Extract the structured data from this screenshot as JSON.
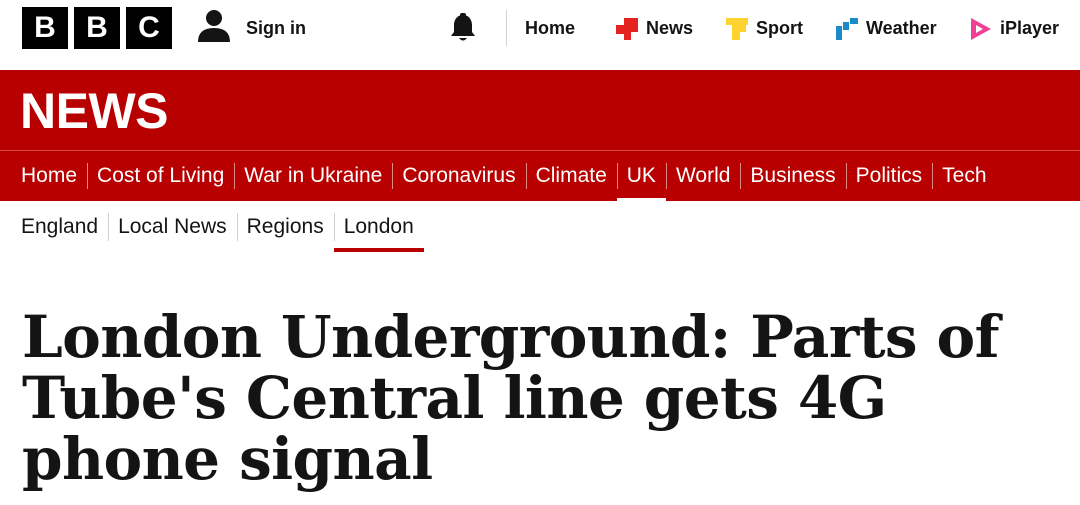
{
  "brand": {
    "letters": [
      "B",
      "B",
      "C"
    ]
  },
  "top_bar": {
    "sign_in_label": "Sign in",
    "nav": [
      {
        "label": "Home",
        "icon": "none"
      },
      {
        "label": "News",
        "icon": "news-icon"
      },
      {
        "label": "Sport",
        "icon": "sport-icon"
      },
      {
        "label": "Weather",
        "icon": "weather-icon"
      },
      {
        "label": "iPlayer",
        "icon": "iplayer-icon"
      }
    ]
  },
  "banner": {
    "title": "NEWS"
  },
  "main_nav": {
    "items": [
      "Home",
      "Cost of Living",
      "War in Ukraine",
      "Coronavirus",
      "Climate",
      "UK",
      "World",
      "Business",
      "Politics",
      "Tech"
    ],
    "active": "UK"
  },
  "sub_nav": {
    "items": [
      "England",
      "Local News",
      "Regions",
      "London"
    ],
    "active": "London"
  },
  "article": {
    "headline": "London Underground: Parts of Tube's Central line gets 4G phone signal"
  },
  "colors": {
    "brand_red": "#b80000",
    "news_icon": "#e42320",
    "sport_icon": "#ffd230",
    "weather_icon": "#1a8ac8",
    "iplayer_icon": "#ef4095",
    "text": "#141414"
  }
}
